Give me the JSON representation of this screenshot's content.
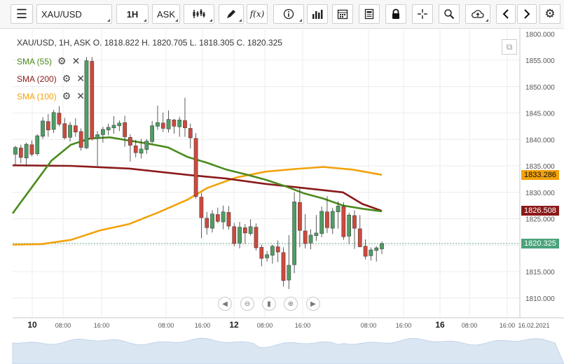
{
  "toolbar": {
    "menu_icon": "hamburger-icon",
    "symbol": "XAU/USD",
    "timeframe": "1H",
    "price_type": "ASK",
    "fx_label": "f(x)",
    "tools": [
      "candles-icon",
      "pencil-icon",
      "fx-icon",
      "info-icon",
      "bar-chart-icon",
      "calendar-icon",
      "report-icon",
      "lock-icon",
      "crosshair-icon",
      "zoom-icon",
      "cloud-upload-icon",
      "prev-arrow-icon",
      "next-arrow-icon",
      "gear-icon"
    ]
  },
  "header": {
    "ohlc_text": "XAU/USD, 1H, ASK   O. 1818.822  H. 1820.705  L. 1818.305  C. 1820.325"
  },
  "indicators": [
    {
      "label": "SMA (55)",
      "color": "#4a8a1c"
    },
    {
      "label": "SMA (200)",
      "color": "#8b1a1a"
    },
    {
      "label": "SMA (100)",
      "color": "#f2a20c"
    }
  ],
  "price_tags": [
    {
      "value": "1833.286",
      "color": "#f2a20c",
      "price": 1833.286
    },
    {
      "value": "1826.508",
      "color": "#8b1a1a",
      "price": 1826.508
    },
    {
      "value": "1820.325",
      "color": "#4aa37a",
      "price": 1820.325
    }
  ],
  "chart_data": {
    "type": "candlestick",
    "symbol": "XAU/USD",
    "timeframe": "1H",
    "y_ticks": [
      "1800.000",
      "1855.000",
      "1850.000",
      "1845.000",
      "1840.000",
      "1835.000",
      "1830.000",
      "1825.000",
      "1820.000",
      "1815.000",
      "1810.000"
    ],
    "y_tick_values": [
      1860,
      1855,
      1850,
      1845,
      1840,
      1835,
      1830,
      1825,
      1820,
      1815,
      1810
    ],
    "x_ticks": [
      "10",
      "08:00",
      "16:00",
      "08:00",
      "16:00",
      "12",
      "08:00",
      "16:00",
      "08:00",
      "16:00",
      "16",
      "08:00",
      "16:00",
      "16.02.2021"
    ],
    "ylim": [
      1806.5,
      1860.5
    ],
    "last_price": 1820.325,
    "candles": [
      [
        1837.2,
        1838.8,
        1835.2,
        1838.5
      ],
      [
        1838.4,
        1839.0,
        1835.5,
        1836.6
      ],
      [
        1836.5,
        1839.4,
        1834.9,
        1839.1
      ],
      [
        1839.0,
        1839.8,
        1836.8,
        1837.2
      ],
      [
        1837.3,
        1841.0,
        1836.9,
        1840.7
      ],
      [
        1840.6,
        1844.2,
        1840.1,
        1843.5
      ],
      [
        1843.4,
        1844.8,
        1840.5,
        1841.8
      ],
      [
        1841.9,
        1845.6,
        1841.2,
        1845.1
      ],
      [
        1845.0,
        1846.3,
        1842.5,
        1842.9
      ],
      [
        1843.0,
        1844.1,
        1840.0,
        1840.3
      ],
      [
        1840.4,
        1843.3,
        1839.6,
        1842.7
      ],
      [
        1842.6,
        1844.0,
        1840.5,
        1841.4
      ],
      [
        1841.5,
        1842.1,
        1837.9,
        1838.5
      ],
      [
        1838.4,
        1855.6,
        1838.2,
        1854.9
      ],
      [
        1854.8,
        1855.6,
        1839.8,
        1840.1
      ],
      [
        1840.2,
        1841.6,
        1835.0,
        1840.9
      ],
      [
        1840.9,
        1842.4,
        1839.4,
        1841.9
      ],
      [
        1841.8,
        1843.0,
        1840.8,
        1842.3
      ],
      [
        1842.2,
        1844.4,
        1841.1,
        1842.7
      ],
      [
        1842.6,
        1843.6,
        1841.6,
        1843.1
      ],
      [
        1843.2,
        1844.5,
        1838.6,
        1840.5
      ],
      [
        1840.4,
        1841.0,
        1835.8,
        1838.9
      ],
      [
        1838.8,
        1839.9,
        1836.6,
        1837.5
      ],
      [
        1837.4,
        1840.1,
        1836.4,
        1838.2
      ],
      [
        1838.1,
        1840.1,
        1837.3,
        1839.7
      ],
      [
        1839.6,
        1843.5,
        1839.3,
        1842.6
      ],
      [
        1842.5,
        1846.4,
        1841.8,
        1843.2
      ],
      [
        1843.1,
        1845.1,
        1841.4,
        1842.1
      ],
      [
        1842.0,
        1845.5,
        1841.3,
        1843.8
      ],
      [
        1843.7,
        1843.9,
        1841.1,
        1842.5
      ],
      [
        1842.4,
        1844.3,
        1840.5,
        1843.7
      ],
      [
        1843.6,
        1847.9,
        1840.5,
        1842.2
      ],
      [
        1842.1,
        1843.0,
        1838.3,
        1840.3
      ],
      [
        1840.2,
        1841.2,
        1828.8,
        1829.2
      ],
      [
        1829.1,
        1829.9,
        1821.3,
        1825.2
      ],
      [
        1825.1,
        1826.3,
        1822.0,
        1823.3
      ],
      [
        1823.2,
        1826.6,
        1822.4,
        1825.9
      ],
      [
        1825.8,
        1827.1,
        1824.2,
        1824.5
      ],
      [
        1824.4,
        1827.5,
        1823.0,
        1826.3
      ],
      [
        1826.2,
        1827.4,
        1823.0,
        1823.6
      ],
      [
        1823.5,
        1824.2,
        1819.8,
        1820.3
      ],
      [
        1820.4,
        1824.4,
        1819.4,
        1823.4
      ],
      [
        1823.3,
        1824.0,
        1820.3,
        1822.3
      ],
      [
        1822.2,
        1824.9,
        1821.8,
        1823.5
      ],
      [
        1823.4,
        1824.1,
        1819.0,
        1819.5
      ],
      [
        1819.6,
        1820.1,
        1816.0,
        1817.5
      ],
      [
        1817.6,
        1818.9,
        1816.9,
        1818.2
      ],
      [
        1818.1,
        1820.1,
        1816.5,
        1819.8
      ],
      [
        1819.7,
        1820.9,
        1816.8,
        1818.7
      ],
      [
        1818.6,
        1819.6,
        1812.2,
        1813.3
      ],
      [
        1813.4,
        1821.9,
        1811.7,
        1816.2
      ],
      [
        1816.3,
        1830.0,
        1814.7,
        1828.2
      ],
      [
        1828.1,
        1831.0,
        1819.6,
        1822.8
      ],
      [
        1822.7,
        1825.9,
        1819.4,
        1820.3
      ],
      [
        1820.4,
        1823.0,
        1819.2,
        1821.9
      ],
      [
        1821.8,
        1825.7,
        1820.8,
        1822.3
      ],
      [
        1822.2,
        1827.3,
        1821.5,
        1826.4
      ],
      [
        1826.3,
        1829.3,
        1822.3,
        1823.3
      ],
      [
        1823.2,
        1827.1,
        1822.1,
        1826.4
      ],
      [
        1826.3,
        1828.3,
        1823.1,
        1827.4
      ],
      [
        1827.3,
        1828.1,
        1821.0,
        1821.6
      ],
      [
        1821.7,
        1826.1,
        1820.2,
        1825.7
      ],
      [
        1825.6,
        1826.6,
        1819.3,
        1823.2
      ],
      [
        1823.1,
        1825.7,
        1819.6,
        1819.7
      ],
      [
        1819.8,
        1821.1,
        1817.3,
        1817.9
      ],
      [
        1818.0,
        1819.6,
        1817.1,
        1819.1
      ],
      [
        1819.0,
        1819.8,
        1816.9,
        1819.5
      ],
      [
        1819.3,
        1820.7,
        1818.3,
        1820.3
      ]
    ],
    "sma_55": [
      [
        0,
        1826.0
      ],
      [
        10,
        1831.0
      ],
      [
        20,
        1836.0
      ],
      [
        30,
        1839.0
      ],
      [
        40,
        1840.2
      ],
      [
        50,
        1840.4
      ],
      [
        60,
        1839.8
      ],
      [
        70,
        1839.2
      ],
      [
        80,
        1838.5
      ],
      [
        90,
        1836.7
      ],
      [
        100,
        1835.6
      ],
      [
        110,
        1834.3
      ],
      [
        120,
        1833.4
      ],
      [
        130,
        1832.4
      ],
      [
        140,
        1831.2
      ],
      [
        150,
        1829.8
      ],
      [
        160,
        1828.8
      ],
      [
        170,
        1827.5
      ],
      [
        180,
        1826.9
      ],
      [
        190,
        1826.4
      ]
    ],
    "sma_200": [
      [
        0,
        1835.1
      ],
      [
        30,
        1835.0
      ],
      [
        60,
        1834.5
      ],
      [
        90,
        1833.3
      ],
      [
        110,
        1832.6
      ],
      [
        130,
        1831.6
      ],
      [
        150,
        1830.8
      ],
      [
        160,
        1830.4
      ],
      [
        170,
        1830.0
      ],
      [
        180,
        1827.8
      ],
      [
        190,
        1826.5
      ]
    ],
    "sma_100": [
      [
        0,
        1820.1
      ],
      [
        15,
        1820.2
      ],
      [
        30,
        1821.0
      ],
      [
        45,
        1822.8
      ],
      [
        60,
        1824.0
      ],
      [
        75,
        1826.2
      ],
      [
        90,
        1828.6
      ],
      [
        100,
        1830.8
      ],
      [
        115,
        1832.8
      ],
      [
        130,
        1833.9
      ],
      [
        145,
        1834.4
      ],
      [
        160,
        1834.8
      ],
      [
        175,
        1834.3
      ],
      [
        190,
        1833.3
      ]
    ]
  }
}
